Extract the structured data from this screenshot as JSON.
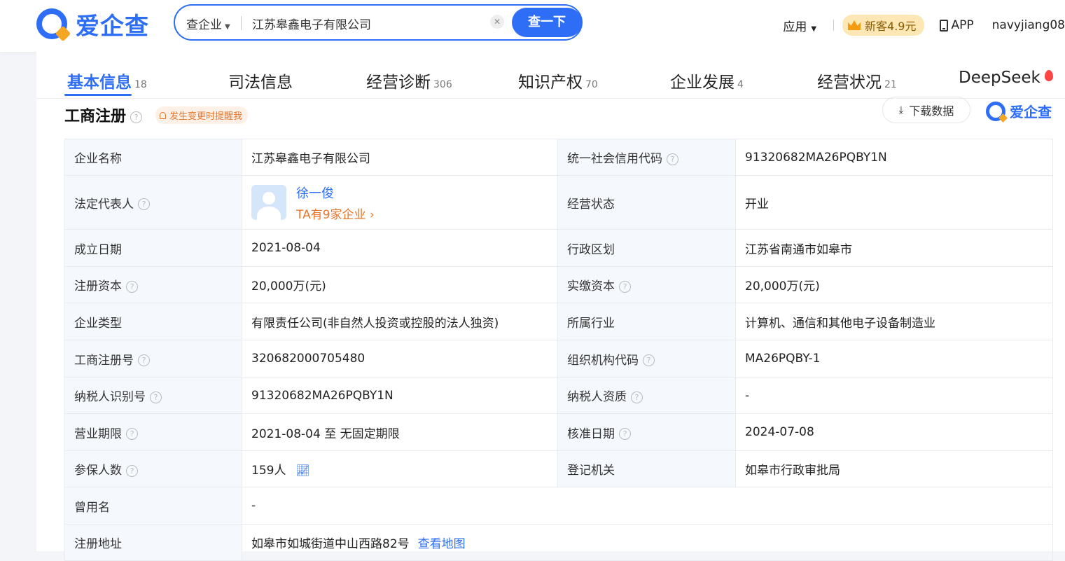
{
  "header": {
    "logo_text": "爱企查",
    "search": {
      "type_label": "查企业",
      "value": "江苏皋鑫电子有限公司",
      "button_label": "查一下"
    },
    "apps_label": "应用",
    "new_customer_label": "新客4.9元",
    "app_label": "APP",
    "username": "navyjiang08"
  },
  "tabs": [
    {
      "label": "基本信息",
      "count": "18"
    },
    {
      "label": "司法信息",
      "count": ""
    },
    {
      "label": "经营诊断",
      "count": "306"
    },
    {
      "label": "知识产权",
      "count": "70"
    },
    {
      "label": "企业发展",
      "count": "4"
    },
    {
      "label": "经营状况",
      "count": "21"
    },
    {
      "label": "DeepSeek",
      "count": ""
    }
  ],
  "section": {
    "title": "工商注册",
    "alert_label": "发生变更时提醒我",
    "download_label": "下载数据",
    "brand": "爱企查"
  },
  "info": {
    "company_name_label": "企业名称",
    "company_name": "江苏皋鑫电子有限公司",
    "credit_code_label": "统一社会信用代码",
    "credit_code": "91320682MA26PQBY1N",
    "legal_rep_label": "法定代表人",
    "legal_rep_name": "徐一俊",
    "legal_rep_link": "TA有9家企业",
    "status_label": "经营状态",
    "status": "开业",
    "founded_label": "成立日期",
    "founded": "2021-08-04",
    "region_label": "行政区划",
    "region": "江苏省南通市如皋市",
    "reg_capital_label": "注册资本",
    "reg_capital": "20,000万(元)",
    "paid_capital_label": "实缴资本",
    "paid_capital": "20,000万(元)",
    "type_label": "企业类型",
    "type": "有限责任公司(非自然人投资或控股的法人独资)",
    "industry_label": "所属行业",
    "industry": "计算机、通信和其他电子设备制造业",
    "reg_no_label": "工商注册号",
    "reg_no": "320682000705480",
    "org_code_label": "组织机构代码",
    "org_code": "MA26PQBY-1",
    "taxpayer_id_label": "纳税人识别号",
    "taxpayer_id": "91320682MA26PQBY1N",
    "taxpayer_qual_label": "纳税人资质",
    "taxpayer_qual": "-",
    "term_label": "营业期限",
    "term": "2021-08-04 至 无固定期限",
    "approval_label": "核准日期",
    "approval": "2024-07-08",
    "insured_label": "参保人数",
    "insured": "159人",
    "authority_label": "登记机关",
    "authority": "如皋市行政审批局",
    "former_name_label": "曾用名",
    "former_name": "-",
    "address_label": "注册地址",
    "address": "如皋市如城街道中山西路82号",
    "map_link": "查看地图"
  },
  "colors": {
    "primary": "#2e6ef7",
    "accent": "#e8752a"
  }
}
